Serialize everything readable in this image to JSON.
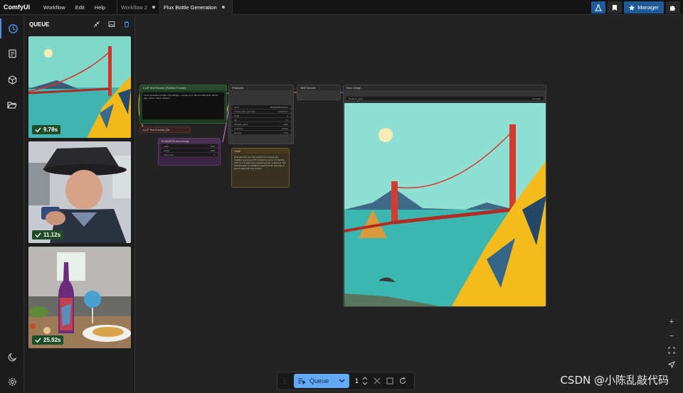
{
  "app": {
    "brand": "ComfyUI"
  },
  "menu": [
    "Workflow",
    "Edit",
    "Help"
  ],
  "tabs": [
    {
      "label": "Workflow 2",
      "active": false
    },
    {
      "label": "Flux Bottle Generation",
      "active": true
    }
  ],
  "topright": {
    "manager_label": "Manager"
  },
  "queue": {
    "title": "QUEUE",
    "items": [
      {
        "time": "9.78s",
        "subject": "golden-gate-bridge-artwork"
      },
      {
        "time": "11.12s",
        "subject": "man-in-hat-with-phone"
      },
      {
        "time": "25.92s",
        "subject": "wine-bottle-with-food"
      }
    ]
  },
  "nodes": {
    "clip_pos": {
      "title": "CLIP Text Encode (Positive Prompt)",
      "text": "vector illustration Golden Gate Bridge - vintage sci-fi, 50s and 60s style, atomic age, vibrant, highly detailed"
    },
    "clip_neg": {
      "title": "CLIP Text Encode (Ne"
    },
    "latent": {
      "title": "EmptySD3LatentImage",
      "widgets": [
        {
          "k": "width",
          "v": "1024"
        },
        {
          "k": "height",
          "v": "1024"
        },
        {
          "k": "batch_size",
          "v": "1"
        }
      ]
    },
    "ksampler": {
      "title": "KSampler",
      "widgets": [
        {
          "k": "seed",
          "v": "834948087182574"
        },
        {
          "k": "control_after_generate",
          "v": "randomize"
        },
        {
          "k": "steps",
          "v": "4"
        },
        {
          "k": "cfg",
          "v": "1.0"
        },
        {
          "k": "sampler_name",
          "v": "euler"
        },
        {
          "k": "scheduler",
          "v": "simple"
        },
        {
          "k": "denoise",
          "v": "1.00"
        }
      ]
    },
    "note": {
      "title": "Note",
      "text": "Note that Flux dev and schnell do not have any negative prompt so CFG should be set to 1.0. Setting CFG to 1.0 means the negative prompt is ignored. The schnell model is a distilled model that can generate a good image with only 4 steps."
    },
    "vae": {
      "title": "VAE Decode"
    },
    "save": {
      "title": "Save Image",
      "prefix_label": "filename_prefix",
      "prefix_value": "ComfyUI"
    }
  },
  "queuebar": {
    "label": "Queue",
    "count": "1"
  },
  "watermark": "CSDN @小陈乱敲代码",
  "colors": {
    "accent": "#4a90e2",
    "queue_button": "#64a9f5",
    "time_badge": "#1f4d27"
  }
}
